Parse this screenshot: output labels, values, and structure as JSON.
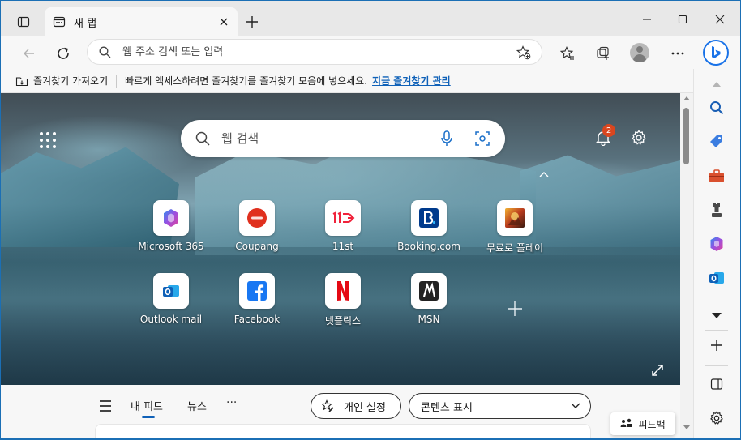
{
  "tab": {
    "title": "새 탭"
  },
  "toolbar": {
    "address_placeholder": "웹 주소 검색 또는 입력"
  },
  "favbar": {
    "import_label": "즐겨찾기 가져오기",
    "message": "빠르게 액세스하려면 즐겨찾기를 즐겨찾기 모음에 넣으세요.",
    "manage_link": "지금 즐겨찾기 관리"
  },
  "newtab": {
    "search_placeholder": "웹 검색",
    "notification_count": "2",
    "tiles": [
      {
        "label": "Microsoft 365",
        "icon": "microsoft-365-icon"
      },
      {
        "label": "Coupang",
        "icon": "coupang-icon"
      },
      {
        "label": "11st",
        "icon": "11st-icon"
      },
      {
        "label": "Booking.com",
        "icon": "booking-icon"
      },
      {
        "label": "무료로 플레이",
        "icon": "game-icon"
      },
      {
        "label": "Outlook mail",
        "icon": "outlook-icon"
      },
      {
        "label": "Facebook",
        "icon": "facebook-icon"
      },
      {
        "label": "넷플릭스",
        "icon": "netflix-icon"
      },
      {
        "label": "MSN",
        "icon": "msn-icon"
      }
    ]
  },
  "feed": {
    "tabs": [
      "내 피드",
      "뉴스"
    ],
    "more": "···",
    "personalize_label": "개인 설정",
    "content_display_label": "콘텐츠 표시",
    "feedback_label": "피드백"
  },
  "colors": {
    "accent": "#0f61b8",
    "badge": "#d9461f",
    "bing": "#1a73e8"
  }
}
